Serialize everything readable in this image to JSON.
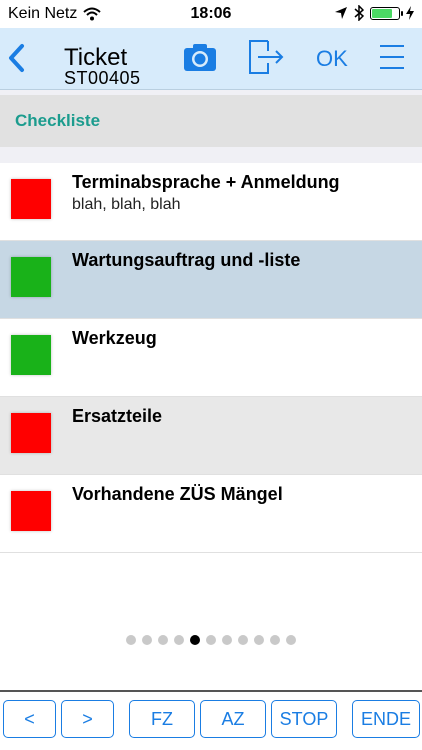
{
  "status_bar": {
    "carrier": "Kein Netz",
    "time": "18:06"
  },
  "nav": {
    "title": "Ticket",
    "subtitle": "ST00405",
    "ok_label": "OK"
  },
  "section": {
    "title": "Checkliste"
  },
  "colors": {
    "red": "#ff0000",
    "green": "#19b219",
    "selected_row": "#c6d7e4",
    "alt_row": "#e8e8e8",
    "accent": "#1a7de3",
    "section_text": "#1c9c8e"
  },
  "items": [
    {
      "title": "Terminabsprache + Anmeldung",
      "subtitle": "blah, blah, blah",
      "status": "red"
    },
    {
      "title": "Wartungsauftrag und -liste",
      "subtitle": "",
      "status": "green"
    },
    {
      "title": "Werkzeug",
      "subtitle": "",
      "status": "green"
    },
    {
      "title": "Ersatzteile",
      "subtitle": "",
      "status": "red"
    },
    {
      "title": "Vorhandene ZÜS Mängel",
      "subtitle": "",
      "status": "red"
    }
  ],
  "pagination": {
    "count": 11,
    "active": 5
  },
  "toolbar": {
    "prev_label": "<",
    "next_label": ">",
    "fz_label": "FZ",
    "az_label": "AZ",
    "stop_label": "STOP",
    "ende_label": "ENDE"
  }
}
